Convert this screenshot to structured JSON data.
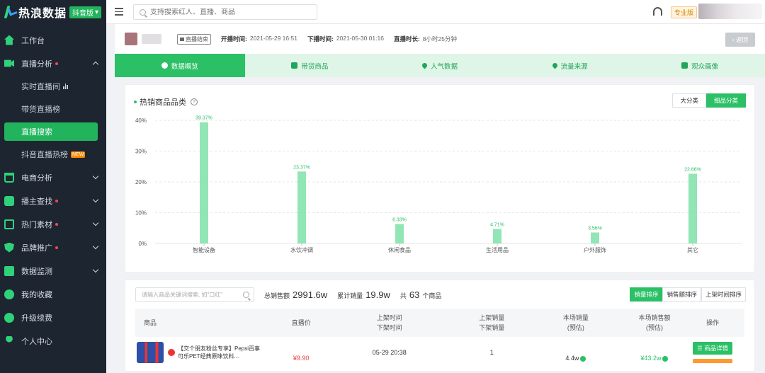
{
  "app": {
    "logo_text": "热浪数据",
    "edition_badge": "抖音版"
  },
  "topbar": {
    "search_placeholder": "支持搜索红人、直播、商品",
    "plan_badge": "专业版"
  },
  "sidebar": {
    "items": [
      {
        "label": "工作台",
        "icon": "home-icon"
      },
      {
        "label": "直播分析",
        "icon": "video-icon",
        "dot": true,
        "expanded": true
      },
      {
        "label": "电商分析",
        "icon": "cart-icon"
      },
      {
        "label": "播主查找",
        "icon": "anchor-icon",
        "dot": true
      },
      {
        "label": "热门素材",
        "icon": "tv-icon",
        "dot": true
      },
      {
        "label": "品牌推广",
        "icon": "shield-icon",
        "dot": true
      },
      {
        "label": "数据监测",
        "icon": "monitor-icon"
      },
      {
        "label": "我的收藏",
        "icon": "star-icon"
      },
      {
        "label": "升级续费",
        "icon": "upgrade-icon"
      },
      {
        "label": "个人中心",
        "icon": "user-icon"
      }
    ],
    "sub_items": [
      {
        "label": "实时直播间"
      },
      {
        "label": "带货直播榜"
      },
      {
        "label": "直播搜索",
        "active": true
      },
      {
        "label": "抖音直播热榜",
        "badge": "NEW"
      }
    ]
  },
  "live": {
    "status": "直播结束",
    "start_label": "开播时间:",
    "start_time": "2021-05-29 16:51",
    "end_label": "下播时间:",
    "end_time": "2021-05-30 01:16",
    "duration_label": "直播时长:",
    "duration": "8小时25分钟",
    "back_label": "返回"
  },
  "tabs": [
    {
      "label": "数据概览",
      "active": true,
      "icon": "pie-icon"
    },
    {
      "label": "带货商品",
      "icon": "goods-icon"
    },
    {
      "label": "人气数据",
      "icon": "flame-icon"
    },
    {
      "label": "流量来源",
      "icon": "drop-icon"
    },
    {
      "label": "观众画像",
      "icon": "portrait-icon"
    }
  ],
  "chart_section": {
    "title": "热销商品品类",
    "toggle": [
      {
        "label": "大分类"
      },
      {
        "label": "细品分类",
        "active": true
      }
    ]
  },
  "chart_data": {
    "type": "bar",
    "categories": [
      "智能设备",
      "水饮冲调",
      "休闲食品",
      "生活用品",
      "户外服饰",
      "其它"
    ],
    "values": [
      39.37,
      23.37,
      6.33,
      4.71,
      3.56,
      22.66
    ],
    "data_labels": [
      "39.37%",
      "23.37%",
      "6.33%",
      "4.71%",
      "3.56%",
      "22.66%"
    ],
    "yticks": [
      "0%",
      "10%",
      "20%",
      "30%",
      "40%"
    ],
    "ylim": [
      0,
      40
    ],
    "grid": true,
    "color": "#7fe0a8"
  },
  "list": {
    "keyword_placeholder": "请输入商品关键词搜索, 如\"口红\"",
    "total_sales_label": "总销售额",
    "total_sales": "2991.6w",
    "total_volume_label": "累计销量",
    "total_volume": "19.9w",
    "count_prefix": "共",
    "count": "63",
    "count_suffix": "个商品",
    "sort_options": [
      {
        "label": "销量排序",
        "active": true
      },
      {
        "label": "销售额排序"
      },
      {
        "label": "上架时间排序"
      }
    ],
    "headers": {
      "product": "商品",
      "price": "直播价",
      "list_time_1": "上架时间",
      "list_time_2": "下架时间",
      "list_sales_1": "上架销量",
      "list_sales_2": "下架销量",
      "sales_1": "本场销量",
      "sales_2": "(预估)",
      "revenue_1": "本场销售额",
      "revenue_2": "(预估)",
      "action": "操作"
    },
    "rows": [
      {
        "name": "【交个朋友粉丝专享】Pepsi百事可乐PET经典原味饮料...",
        "price": "¥9.90",
        "list_time": "05-29 20:38",
        "list_sales": "1",
        "sales": "4.4w",
        "revenue": "¥43.2w",
        "detail_label": "商品详情"
      }
    ]
  }
}
